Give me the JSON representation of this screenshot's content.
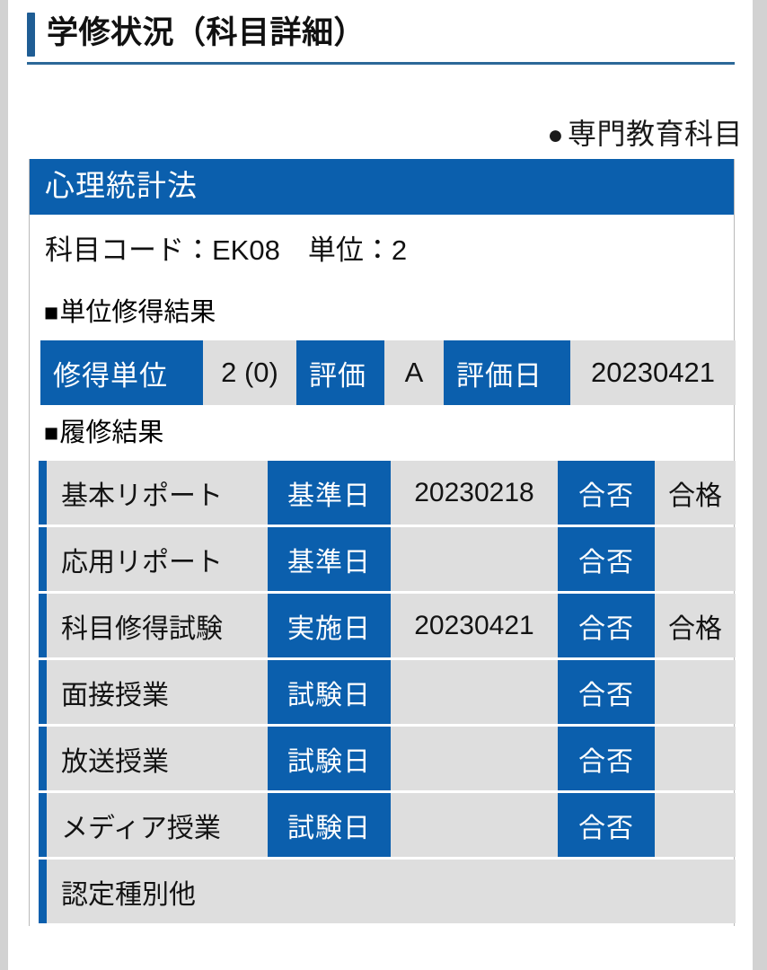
{
  "header": {
    "title": "学修状況（科目詳細）",
    "category_bullet": "●",
    "category_label": "専門教育科目"
  },
  "course": {
    "name": "心理統計法",
    "meta": "科目コード：EK08　単位：2",
    "code_label": "科目コード",
    "code_value": "EK08",
    "credits_label": "単位",
    "credits_value": "2"
  },
  "credit_result": {
    "heading": "■単位修得結果",
    "heading_marker": "■",
    "heading_text": "単位修得結果",
    "earned_credits_label": "修得単位",
    "earned_credits_value": "2 (0)",
    "grade_label": "評価",
    "grade_value": "A",
    "grade_date_label": "評価日",
    "grade_date_value": "20230421"
  },
  "enrollment_result": {
    "heading": "■履修結果",
    "heading_marker": "■",
    "heading_text": "履修結果",
    "rows": [
      {
        "name": "基本リポート",
        "date_label": "基準日",
        "date_value": "20230218",
        "pass_label": "合否",
        "pass_value": "合格"
      },
      {
        "name": "応用リポート",
        "date_label": "基準日",
        "date_value": "",
        "pass_label": "合否",
        "pass_value": ""
      },
      {
        "name": "科目修得試験",
        "date_label": "実施日",
        "date_value": "20230421",
        "pass_label": "合否",
        "pass_value": "合格"
      },
      {
        "name": "面接授業",
        "date_label": "試験日",
        "date_value": "",
        "pass_label": "合否",
        "pass_value": ""
      },
      {
        "name": "放送授業",
        "date_label": "試験日",
        "date_value": "",
        "pass_label": "合否",
        "pass_value": ""
      },
      {
        "name": "メディア授業",
        "date_label": "試験日",
        "date_value": "",
        "pass_label": "合否",
        "pass_value": ""
      }
    ],
    "last_row": {
      "name": "認定種別他"
    }
  },
  "colors": {
    "accent_blue": "#0b5fad",
    "title_bar_blue": "#1f5d94",
    "rule_blue": "#2c6898",
    "row_gray": "#dedede",
    "page_gray": "#d2d2d2"
  }
}
